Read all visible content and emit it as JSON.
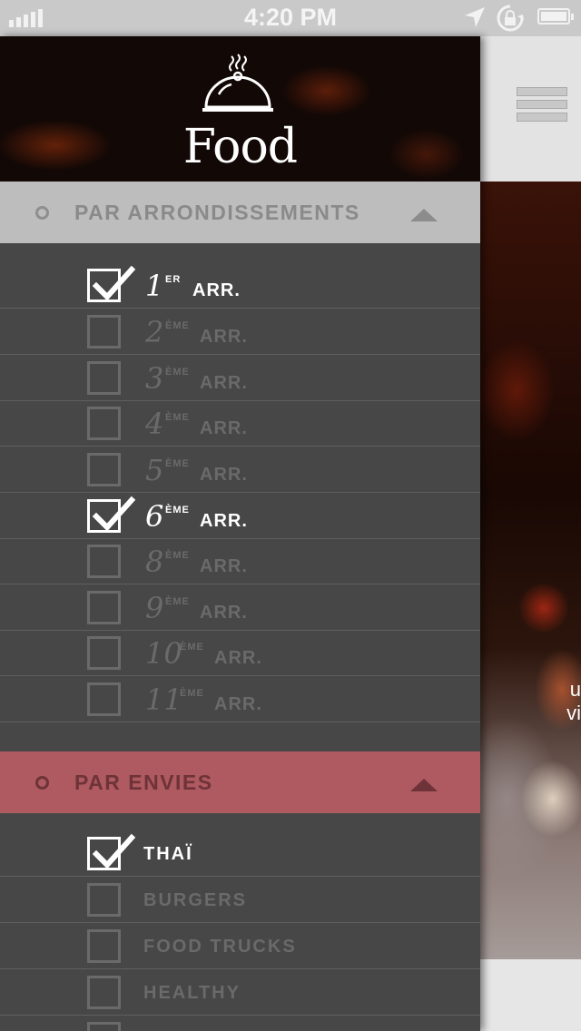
{
  "status_bar": {
    "time": "4:20 PM"
  },
  "header": {
    "brand": "Food"
  },
  "section_arrondissements": {
    "label": "PAR ARRONDISSEMENTS",
    "items": [
      {
        "num": "1",
        "sup": "ER",
        "arr": "ARR.",
        "checked": true
      },
      {
        "num": "2",
        "sup": "ÈME",
        "arr": "ARR.",
        "checked": false
      },
      {
        "num": "3",
        "sup": "ÈME",
        "arr": "ARR.",
        "checked": false
      },
      {
        "num": "4",
        "sup": "ÈME",
        "arr": "ARR.",
        "checked": false
      },
      {
        "num": "5",
        "sup": "ÈME",
        "arr": "ARR.",
        "checked": false
      },
      {
        "num": "6",
        "sup": "ÈME",
        "arr": "ARR.",
        "checked": true
      },
      {
        "num": "8",
        "sup": "ÈME",
        "arr": "ARR.",
        "checked": false
      },
      {
        "num": "9",
        "sup": "ÈME",
        "arr": "ARR.",
        "checked": false
      },
      {
        "num": "10",
        "sup": "ÈME",
        "arr": "ARR.",
        "checked": false
      },
      {
        "num": "11",
        "sup": "ÈME",
        "arr": "ARR.",
        "checked": false
      }
    ]
  },
  "section_envies": {
    "label": "PAR ENVIES",
    "items": [
      {
        "label": "THAÏ",
        "checked": true
      },
      {
        "label": "BURGERS",
        "checked": false
      },
      {
        "label": "FOOD TRUCKS",
        "checked": false
      },
      {
        "label": "HEALTHY",
        "checked": false
      }
    ]
  },
  "main": {
    "photo_text_line1": "u",
    "photo_text_line2": "vi"
  },
  "icons": {
    "signal": "signal-bars-icon",
    "location": "location-arrow-icon",
    "rotation_lock": "rotation-lock-icon",
    "battery": "battery-icon",
    "cloche": "cloche-icon",
    "menu": "hamburger-menu-icon",
    "checkbox": "checkbox-icon",
    "checkmark": "checkmark-icon"
  },
  "colors": {
    "drawer_bg": "#474747",
    "section_grey": "#bdbdbd",
    "section_red": "#ae5a60",
    "checked_text": "#ffffff",
    "unchecked_text": "#6a6a6a"
  }
}
